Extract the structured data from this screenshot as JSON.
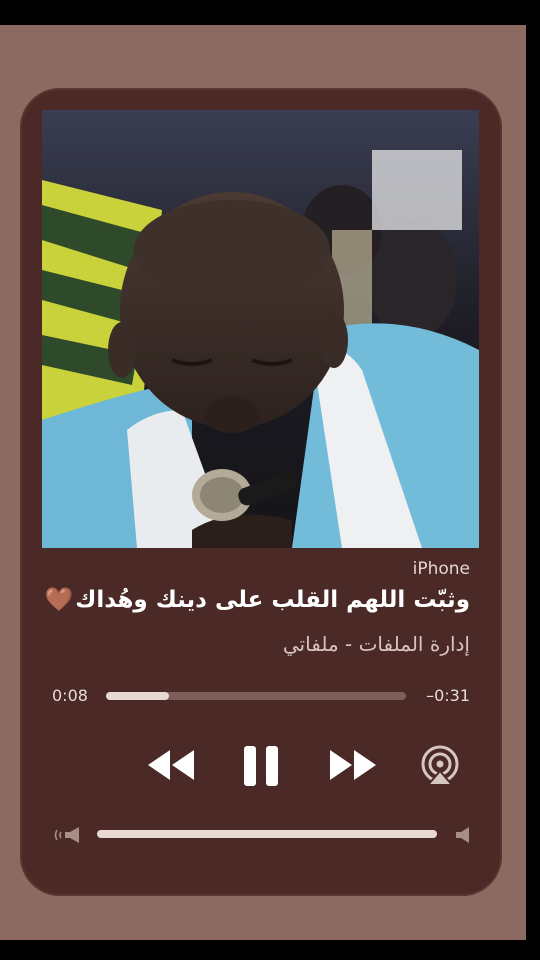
{
  "player": {
    "source": "iPhone",
    "title": "وثبّت اللهم القلب على دينك وهُداك",
    "title_emoji": "🤎",
    "artist": "إدارة الملفات - ملفاتي",
    "elapsed": "0:08",
    "remaining": "–0:31",
    "progress": 0.21,
    "volume": 1.0,
    "state": "playing"
  },
  "colors": {
    "page_bg": "#8c6a62",
    "card_bg": "#4a2926",
    "accent": "#e9d9d5"
  },
  "icons": {
    "rewind": "rewind-icon",
    "pause": "pause-icon",
    "forward": "fast-forward-icon",
    "airplay": "airplay-icon",
    "volume_low": "volume-low-icon",
    "volume_high": "volume-high-icon"
  }
}
